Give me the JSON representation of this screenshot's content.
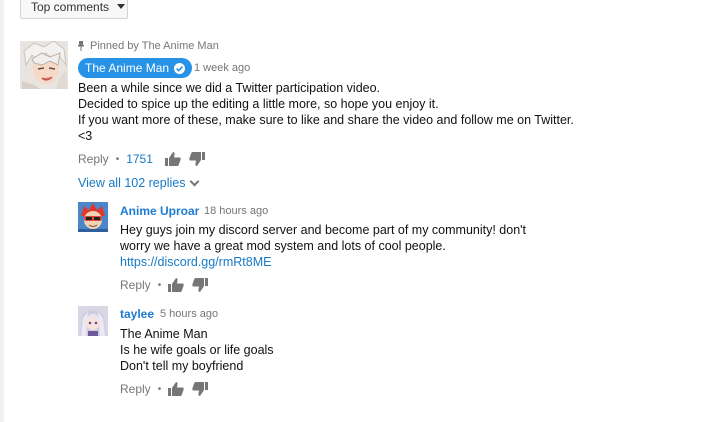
{
  "sort": {
    "label": "Top comments"
  },
  "pinned_comment": {
    "pinned_label": "Pinned by The Anime Man",
    "author": "The Anime Man",
    "time": "1 week ago",
    "lines": [
      "Been a while since we did a Twitter participation video.",
      "Decided to spice up the editing a little more, so hope you enjoy it.",
      "If you want more of these, make sure to like and share the video and follow me on Twitter.",
      "<3"
    ],
    "reply_label": "Reply",
    "likes": "1751",
    "view_replies_label": "View all 102 replies"
  },
  "replies": [
    {
      "author": "Anime Uproar",
      "time": "18 hours ago",
      "lines": [
        "Hey guys join my discord server and become part of my community! don't",
        "worry we have a great mod system and lots of cool people."
      ],
      "link": "https://discord.gg/rmRt8ME",
      "reply_label": "Reply"
    },
    {
      "author": "taylee",
      "time": "5 hours ago",
      "lines": [
        "The Anime Man",
        "Is he wife goals or life goals",
        "Don't tell my boyfriend"
      ],
      "reply_label": "Reply"
    }
  ],
  "colors": {
    "badge": "#2793e6",
    "link": "#167ac6",
    "muted": "#767676"
  },
  "icons": [
    "pin-icon",
    "verified-check-icon",
    "thumbs-up-icon",
    "thumbs-down-icon",
    "chevron-down-icon"
  ]
}
